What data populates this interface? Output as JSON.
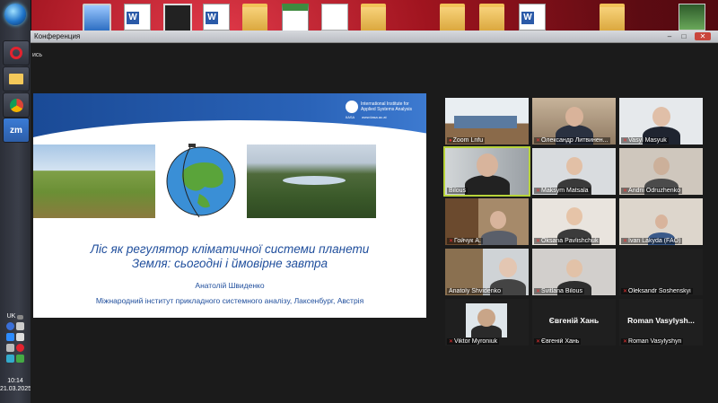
{
  "window": {
    "title": "Конференция",
    "sub_label": "ись",
    "controls": [
      "–",
      "□",
      "✕"
    ]
  },
  "taskbar": {
    "pinned": [
      "opera-icon",
      "folder-icon",
      "chrome-icon",
      "zoom-icon"
    ],
    "zoom_label": "zm",
    "lang": "UK",
    "time": "10:14",
    "date": "21.03.2025"
  },
  "desktop": {
    "icons": [
      "computer-icon",
      "word-doc-icon",
      "video-icon",
      "word-doc-icon",
      "folder-icon",
      "spreadsheet-icon",
      "document-icon",
      "folder-icon",
      "folder-icon",
      "folder-icon",
      "word-doc-icon",
      "folder-icon",
      "image-icon"
    ]
  },
  "slide": {
    "org_name": "International Institute for Applied Systems Analysis",
    "org_abbr": "IIASA",
    "org_url": "www.iiasa.ac.at",
    "title_line1": "Ліс як регулятор кліматичної системи планети",
    "title_line2": "Земля: сьогодні  і ймовірне завтра",
    "author": "Анатолій Швиденко",
    "institute": "Міжнародний інститут прикладного системного аналізу, Лаксенбург, Австрія"
  },
  "participants": [
    {
      "name": "Zoom Lnfu",
      "muted": false,
      "video": true
    },
    {
      "name": "Олександр Литвинен...",
      "muted": true,
      "video": true
    },
    {
      "name": "Vasyl Masyuk",
      "muted": true,
      "video": true
    },
    {
      "name": "Bilous",
      "muted": false,
      "video": true,
      "active": true
    },
    {
      "name": "Maksym Matsala",
      "muted": true,
      "video": true
    },
    {
      "name": "Andrii Odruzhenko",
      "muted": true,
      "video": true
    },
    {
      "name": "Гойчук А.",
      "muted": true,
      "video": true
    },
    {
      "name": "Oksana Pavlishchuk",
      "muted": true,
      "video": true
    },
    {
      "name": "Ivan Lakyda (FAO)",
      "muted": true,
      "video": true
    },
    {
      "name": "Anatoly Shvidenko",
      "muted": false,
      "video": true
    },
    {
      "name": "Svitlana Bilous",
      "muted": true,
      "video": true
    },
    {
      "name": "Oleksandr Soshenskyi",
      "muted": true,
      "video": false,
      "display_name": ""
    },
    {
      "name": "Viktor Myroniuk",
      "muted": true,
      "video": true
    },
    {
      "name": "Євгеній Хань",
      "muted": true,
      "video": false,
      "display_name": "Євгеній Хань"
    },
    {
      "name": "Roman Vasylyshyn",
      "muted": true,
      "video": false,
      "display_name": "Roman  Vasylysh..."
    }
  ]
}
